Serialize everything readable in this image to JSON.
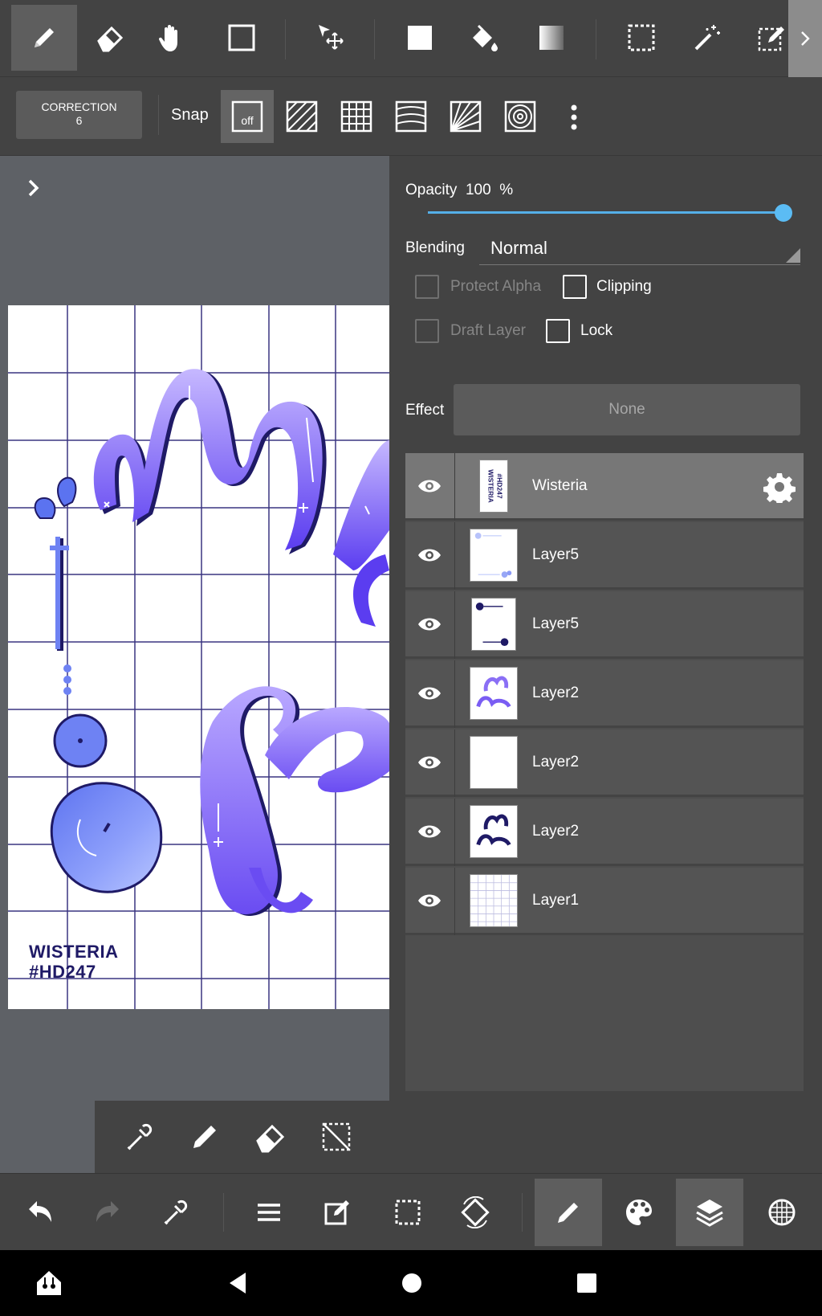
{
  "toolbar_top": {
    "tools": [
      "pen",
      "eraser",
      "hand",
      "rectangle",
      "move",
      "fill-shape",
      "bucket",
      "gradient",
      "select-rect",
      "magic-wand",
      "select-pen"
    ]
  },
  "toolbar_second": {
    "correction_label": "CORRECTION",
    "correction_value": "6",
    "snap_label": "Snap",
    "snap_off_label": "off"
  },
  "artwork": {
    "label_line1": "WISTERIA",
    "label_line2": "#HD247",
    "colors": {
      "violet": "#6b4cf0",
      "lavender": "#b8a9ff",
      "navy": "#1f1a66",
      "grid": "#3a3580"
    }
  },
  "layer_panel": {
    "opacity_label": "Opacity",
    "opacity_value": "100",
    "opacity_unit": "%",
    "opacity_fraction": 1.0,
    "blending_label": "Blending",
    "blending_value": "Normal",
    "protect_alpha": "Protect Alpha",
    "clipping": "Clipping",
    "draft_layer": "Draft Layer",
    "lock": "Lock",
    "effect_label": "Effect",
    "effect_value": "None",
    "layers": [
      {
        "name": "Wisteria",
        "selected": true,
        "thumb_text": "WISTERIA #HD247"
      },
      {
        "name": "Layer5",
        "selected": false
      },
      {
        "name": "Layer5",
        "selected": false
      },
      {
        "name": "Layer2",
        "selected": false
      },
      {
        "name": "Layer2",
        "selected": false
      },
      {
        "name": "Layer2",
        "selected": false
      },
      {
        "name": "Layer1",
        "selected": false
      }
    ]
  },
  "accent_color": "#4a8fc6",
  "slider_color": "#5bbcf4"
}
